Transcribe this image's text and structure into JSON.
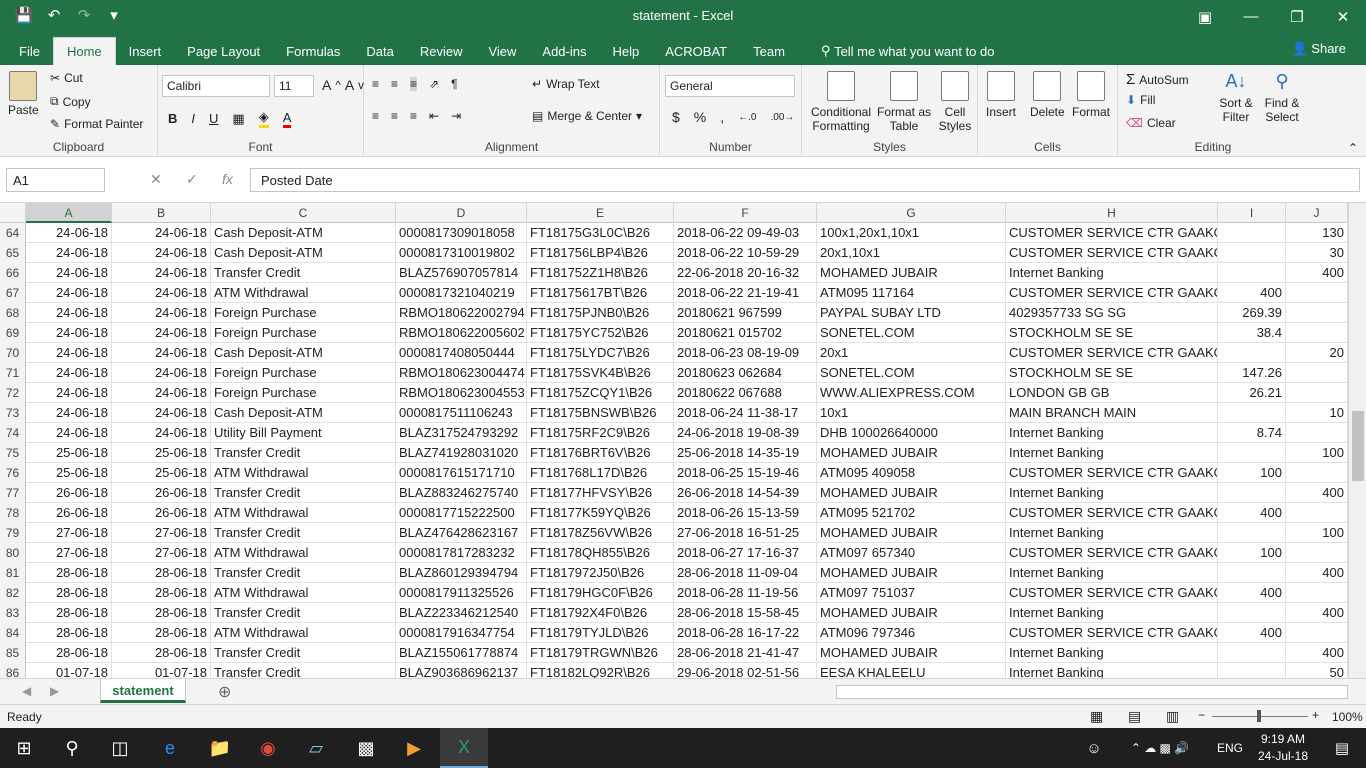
{
  "window": {
    "title": "statement - Excel"
  },
  "ribbon_tabs": [
    "File",
    "Home",
    "Insert",
    "Page Layout",
    "Formulas",
    "Data",
    "Review",
    "View",
    "Add-ins",
    "Help",
    "ACROBAT",
    "Team"
  ],
  "tell_me": "Tell me what you want to do",
  "share": "Share",
  "clipboard": {
    "paste": "Paste",
    "cut": "Cut",
    "copy": "Copy",
    "format_painter": "Format Painter",
    "label": "Clipboard"
  },
  "font": {
    "name": "Calibri",
    "size": "11",
    "label": "Font",
    "bold": "B",
    "italic": "I",
    "underline": "U"
  },
  "alignment": {
    "wrap": "Wrap Text",
    "merge": "Merge & Center",
    "label": "Alignment"
  },
  "number": {
    "format": "General",
    "label": "Number",
    "currency": "$",
    "percent": "%",
    "comma": ","
  },
  "styles": {
    "conditional": "Conditional Formatting",
    "format_table": "Format as Table",
    "cell_styles": "Cell Styles",
    "label": "Styles"
  },
  "cells": {
    "insert": "Insert",
    "delete": "Delete",
    "format": "Format",
    "label": "Cells"
  },
  "editing": {
    "autosum": "AutoSum",
    "fill": "Fill",
    "clear": "Clear",
    "sort": "Sort & Filter",
    "find": "Find & Select",
    "label": "Editing"
  },
  "formula": {
    "name_box": "A1",
    "content": "Posted Date"
  },
  "columns": [
    "A",
    "B",
    "C",
    "D",
    "E",
    "F",
    "G",
    "H",
    "I",
    "J"
  ],
  "rows": [
    {
      "n": "64",
      "a": "24-06-18",
      "b": "24-06-18",
      "c": "Cash Deposit-ATM",
      "d": "0000817309018058",
      "e": "FT18175G3L0C\\B26",
      "f": "2018-06-22 09-49-03",
      "g": "100x1,20x1,10x1",
      "h": "CUSTOMER SERVICE CTR GAAKOSHI",
      "i": "",
      "j": "130"
    },
    {
      "n": "65",
      "a": "24-06-18",
      "b": "24-06-18",
      "c": "Cash Deposit-ATM",
      "d": "0000817310019802",
      "e": "FT181756LBP4\\B26",
      "f": "2018-06-22 10-59-29",
      "g": "20x1,10x1",
      "h": "CUSTOMER SERVICE CTR GAAKOSHI",
      "i": "",
      "j": "30"
    },
    {
      "n": "66",
      "a": "24-06-18",
      "b": "24-06-18",
      "c": "Transfer Credit",
      "d": "BLAZ576907057814",
      "e": "FT181752Z1H8\\B26",
      "f": "22-06-2018 20-16-32",
      "g": "MOHAMED JUBAIR",
      "h": "Internet Banking",
      "i": "",
      "j": "400"
    },
    {
      "n": "67",
      "a": "24-06-18",
      "b": "24-06-18",
      "c": "ATM Withdrawal",
      "d": "0000817321040219",
      "e": "FT18175617BT\\B26",
      "f": "2018-06-22 21-19-41",
      "g": "ATM095 117164",
      "h": "CUSTOMER SERVICE CTR GAAKOSH",
      "i": "400",
      "j": ""
    },
    {
      "n": "68",
      "a": "24-06-18",
      "b": "24-06-18",
      "c": "Foreign Purchase",
      "d": "RBMO180622002794",
      "e": "FT18175PJNB0\\B26",
      "f": "20180621 967599",
      "g": "PAYPAL SUBAY LTD",
      "h": "4029357733 SG SG",
      "i": "269.39",
      "j": ""
    },
    {
      "n": "69",
      "a": "24-06-18",
      "b": "24-06-18",
      "c": "Foreign Purchase",
      "d": "RBMO180622005602",
      "e": "FT18175YC752\\B26",
      "f": "20180621 015702",
      "g": "SONETEL.COM",
      "h": "STOCKHOLM SE SE",
      "i": "38.4",
      "j": ""
    },
    {
      "n": "70",
      "a": "24-06-18",
      "b": "24-06-18",
      "c": "Cash Deposit-ATM",
      "d": "0000817408050444",
      "e": "FT18175LYDC7\\B26",
      "f": "2018-06-23 08-19-09",
      "g": "20x1",
      "h": "CUSTOMER SERVICE CTR GAAKOSHI",
      "i": "",
      "j": "20"
    },
    {
      "n": "71",
      "a": "24-06-18",
      "b": "24-06-18",
      "c": "Foreign Purchase",
      "d": "RBMO180623004474",
      "e": "FT18175SVK4B\\B26",
      "f": "20180623 062684",
      "g": "SONETEL.COM",
      "h": "STOCKHOLM SE SE",
      "i": "147.26",
      "j": ""
    },
    {
      "n": "72",
      "a": "24-06-18",
      "b": "24-06-18",
      "c": "Foreign Purchase",
      "d": "RBMO180623004553",
      "e": "FT18175ZCQY1\\B26",
      "f": "20180622 067688",
      "g": "WWW.ALIEXPRESS.COM",
      "h": "LONDON GB GB",
      "i": "26.21",
      "j": ""
    },
    {
      "n": "73",
      "a": "24-06-18",
      "b": "24-06-18",
      "c": "Cash Deposit-ATM",
      "d": "0000817511106243",
      "e": "FT18175BNSWB\\B26",
      "f": "2018-06-24 11-38-17",
      "g": "10x1",
      "h": "MAIN BRANCH MAIN",
      "i": "",
      "j": "10"
    },
    {
      "n": "74",
      "a": "24-06-18",
      "b": "24-06-18",
      "c": "Utility Bill Payment",
      "d": "BLAZ317524793292",
      "e": "FT18175RF2C9\\B26",
      "f": "24-06-2018 19-08-39",
      "g": "DHB 100026640000",
      "h": "Internet Banking",
      "i": "8.74",
      "j": ""
    },
    {
      "n": "75",
      "a": "25-06-18",
      "b": "25-06-18",
      "c": "Transfer Credit",
      "d": "BLAZ741928031020",
      "e": "FT18176BRT6V\\B26",
      "f": "25-06-2018 14-35-19",
      "g": "MOHAMED JUBAIR",
      "h": "Internet Banking",
      "i": "",
      "j": "100"
    },
    {
      "n": "76",
      "a": "25-06-18",
      "b": "25-06-18",
      "c": "ATM Withdrawal",
      "d": "0000817615171710",
      "e": "FT181768L17D\\B26",
      "f": "2018-06-25 15-19-46",
      "g": "ATM095 409058",
      "h": "CUSTOMER SERVICE CTR GAAKOSH",
      "i": "100",
      "j": ""
    },
    {
      "n": "77",
      "a": "26-06-18",
      "b": "26-06-18",
      "c": "Transfer Credit",
      "d": "BLAZ883246275740",
      "e": "FT18177HFVSY\\B26",
      "f": "26-06-2018 14-54-39",
      "g": "MOHAMED JUBAIR",
      "h": "Internet Banking",
      "i": "",
      "j": "400"
    },
    {
      "n": "78",
      "a": "26-06-18",
      "b": "26-06-18",
      "c": "ATM Withdrawal",
      "d": "0000817715222500",
      "e": "FT18177K59YQ\\B26",
      "f": "2018-06-26 15-13-59",
      "g": "ATM095 521702",
      "h": "CUSTOMER SERVICE CTR GAAKOSH",
      "i": "400",
      "j": ""
    },
    {
      "n": "79",
      "a": "27-06-18",
      "b": "27-06-18",
      "c": "Transfer Credit",
      "d": "BLAZ476428623167",
      "e": "FT18178Z56VW\\B26",
      "f": "27-06-2018 16-51-25",
      "g": "MOHAMED JUBAIR",
      "h": "Internet Banking",
      "i": "",
      "j": "100"
    },
    {
      "n": "80",
      "a": "27-06-18",
      "b": "27-06-18",
      "c": "ATM Withdrawal",
      "d": "0000817817283232",
      "e": "FT18178QH855\\B26",
      "f": "2018-06-27 17-16-37",
      "g": "ATM097 657340",
      "h": "CUSTOMER SERVICE CTR GAAKOSH",
      "i": "100",
      "j": ""
    },
    {
      "n": "81",
      "a": "28-06-18",
      "b": "28-06-18",
      "c": "Transfer Credit",
      "d": "BLAZ860129394794",
      "e": "FT1817972J50\\B26",
      "f": "28-06-2018 11-09-04",
      "g": "MOHAMED JUBAIR",
      "h": "Internet Banking",
      "i": "",
      "j": "400"
    },
    {
      "n": "82",
      "a": "28-06-18",
      "b": "28-06-18",
      "c": "ATM Withdrawal",
      "d": "0000817911325526",
      "e": "FT18179HGC0F\\B26",
      "f": "2018-06-28 11-19-56",
      "g": "ATM097 751037",
      "h": "CUSTOMER SERVICE CTR GAAKOSH",
      "i": "400",
      "j": ""
    },
    {
      "n": "83",
      "a": "28-06-18",
      "b": "28-06-18",
      "c": "Transfer Credit",
      "d": "BLAZ223346212540",
      "e": "FT181792X4F0\\B26",
      "f": "28-06-2018 15-58-45",
      "g": "MOHAMED JUBAIR",
      "h": "Internet Banking",
      "i": "",
      "j": "400"
    },
    {
      "n": "84",
      "a": "28-06-18",
      "b": "28-06-18",
      "c": "ATM Withdrawal",
      "d": "0000817916347754",
      "e": "FT18179TYJLD\\B26",
      "f": "2018-06-28 16-17-22",
      "g": "ATM096 797346",
      "h": "CUSTOMER SERVICE CTR GAAKOSH",
      "i": "400",
      "j": ""
    },
    {
      "n": "85",
      "a": "28-06-18",
      "b": "28-06-18",
      "c": "Transfer Credit",
      "d": "BLAZ155061778874",
      "e": "FT18179TRGWN\\B26",
      "f": "28-06-2018 21-41-47",
      "g": "MOHAMED JUBAIR",
      "h": "Internet Banking",
      "i": "",
      "j": "400"
    },
    {
      "n": "86",
      "a": "01-07-18",
      "b": "01-07-18",
      "c": "Transfer Credit",
      "d": "BLAZ903686962137",
      "e": "FT18182LQ92R\\B26",
      "f": "29-06-2018 02-51-56",
      "g": "EESA KHALEELU",
      "h": "Internet Banking",
      "i": "",
      "j": "50"
    }
  ],
  "sheet": {
    "tab": "statement"
  },
  "status": {
    "ready": "Ready",
    "zoom": "100%"
  },
  "taskbar": {
    "lang": "ENG",
    "time": "9:19 AM",
    "date": "24-Jul-18"
  }
}
